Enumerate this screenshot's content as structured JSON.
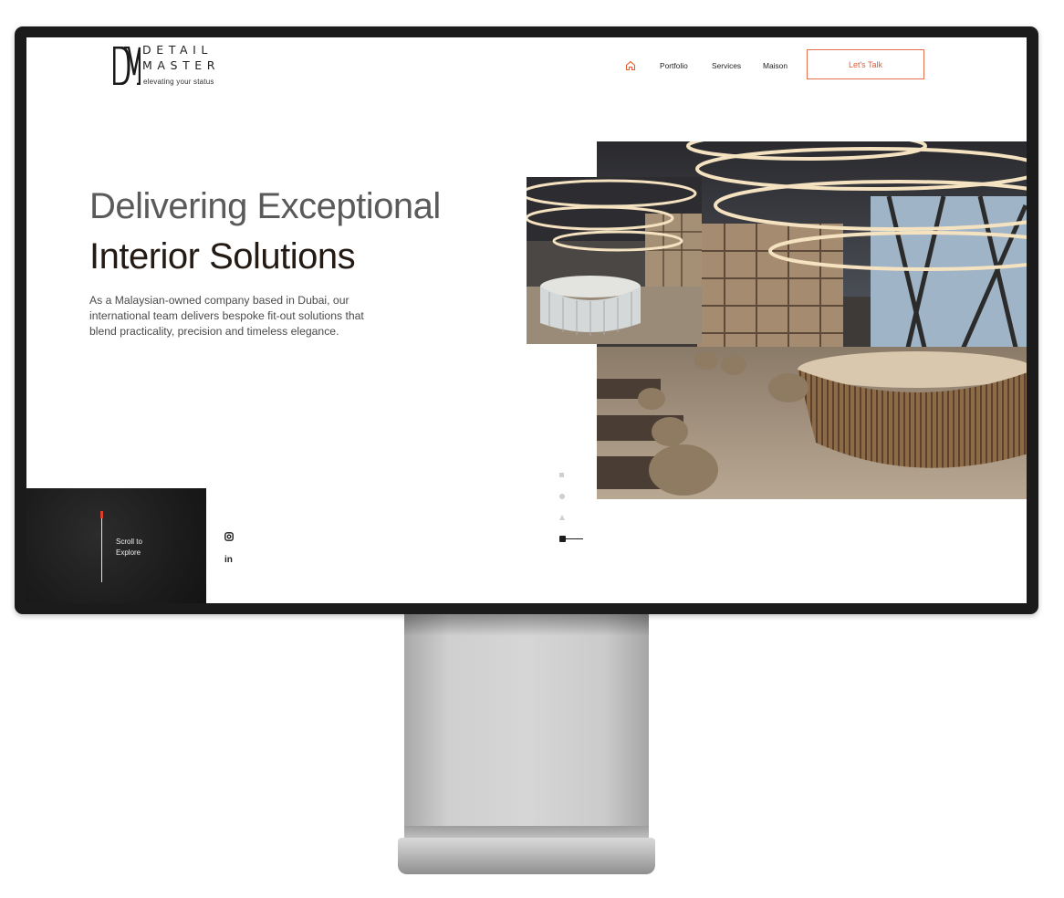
{
  "brand": {
    "logo_word_line1": "DETAIL",
    "logo_word_line2": "MASTER",
    "tagline": "elevating your status"
  },
  "nav": {
    "home_icon": "home-icon",
    "items": [
      {
        "label": "Portfolio"
      },
      {
        "label": "Services"
      },
      {
        "label": "Maison"
      }
    ],
    "cta_label": "Let's Talk"
  },
  "hero": {
    "title_line1": "Delivering Exceptional",
    "title_line2": "Interior Solutions",
    "description": "As a Malaysian-owned company based in Dubai, our international team delivers bespoke fit-out solutions that blend practicality, precision and timeless elegance."
  },
  "scroll": {
    "line1": "Scroll to",
    "line2": "Explore"
  },
  "social": {
    "icons": [
      "instagram-icon",
      "linkedin-icon"
    ],
    "linkedin_glyph": "in"
  },
  "slider": {
    "count": 4,
    "active_index": 3
  },
  "colors": {
    "accent": "#e55a2f",
    "title_gray": "#5a5a5a",
    "title_dark": "#231a14",
    "bezel": "#1b1b1b"
  }
}
